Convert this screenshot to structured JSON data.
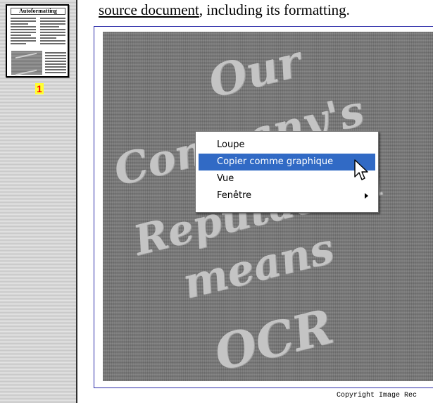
{
  "sidebar": {
    "thumbnail": {
      "title": "Autoformatting",
      "icon": "page-thumbnail-icon"
    },
    "page_number": "1"
  },
  "document": {
    "heading_link": "source document",
    "heading_rest": ", including its formatting.",
    "image_text": [
      "Our",
      "Company's",
      "Reputation",
      "means",
      "OCR"
    ],
    "copyright": "Copyright Image Rec"
  },
  "context_menu": {
    "items": [
      {
        "label": "Loupe"
      },
      {
        "label": "Copier comme graphique",
        "highlighted": true
      },
      {
        "label": "Vue"
      },
      {
        "label": "Fenêtre",
        "submenu": true
      }
    ]
  },
  "colors": {
    "menu_highlight": "#316ac5",
    "frame_border": "#2a2aa8",
    "page_number_bg": "#ffff33",
    "page_number_fg": "#ff0000"
  },
  "icons": [
    "page-thumbnail-icon",
    "submenu-arrow-icon",
    "mouse-pointer-icon"
  ]
}
